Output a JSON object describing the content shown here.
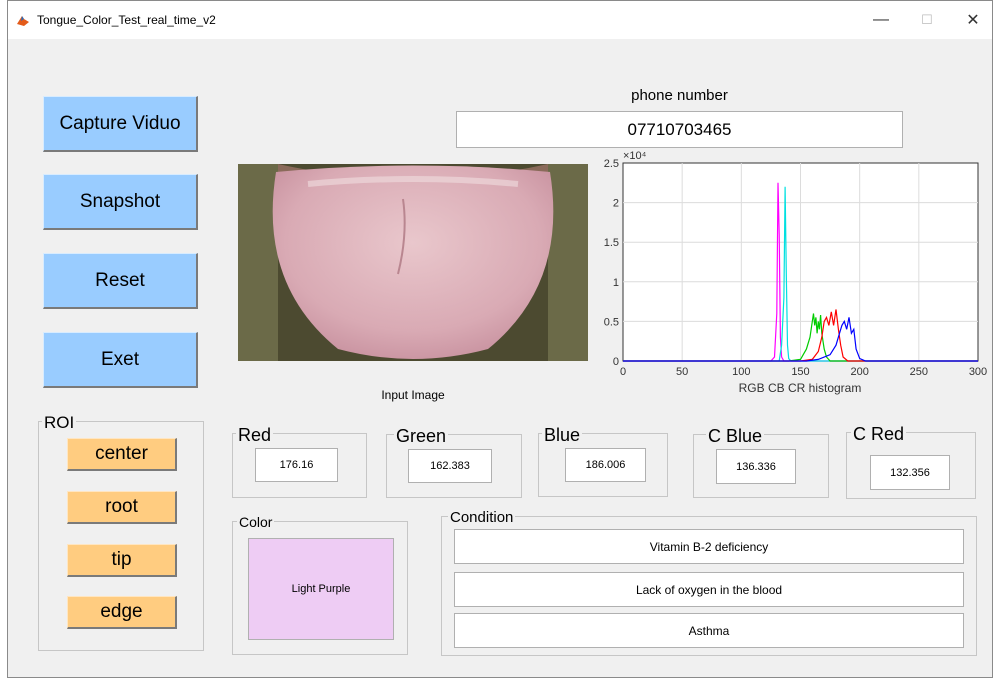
{
  "window": {
    "title": "Tongue_Color_Test_real_time_v2",
    "minimize_glyph": "—",
    "maximize_glyph": "☐",
    "close_glyph": "✕"
  },
  "buttons": {
    "capture": "Capture Viduo",
    "snapshot": "Snapshot",
    "reset": "Reset",
    "exit": "Exet"
  },
  "phone": {
    "label": "phone number",
    "value": "07710703465"
  },
  "image_label": "Input Image",
  "roi": {
    "title": "ROI",
    "center": "center",
    "root": "root",
    "tip": "tip",
    "edge": "edge"
  },
  "channels": {
    "red": {
      "label": "Red",
      "value": "176.16"
    },
    "green": {
      "label": "Green",
      "value": "162.383"
    },
    "blue": {
      "label": "Blue",
      "value": "186.006"
    },
    "cblue": {
      "label": "C Blue",
      "value": "136.336"
    },
    "cred": {
      "label": "C Red",
      "value": "132.356"
    }
  },
  "color": {
    "title": "Color",
    "value": "Light Purple",
    "swatch": "#eeccf4"
  },
  "condition": {
    "title": "Condition",
    "items": [
      "Vitamin B-2 deficiency",
      "Lack of oxygen in the blood",
      "Asthma"
    ]
  },
  "chart_data": {
    "type": "line",
    "xlabel": "RGB CB CR histogram",
    "ylabel": "",
    "exponent_label": "×10⁴",
    "xlim": [
      0,
      300
    ],
    "ylim": [
      0,
      2.5
    ],
    "xticks": [
      0,
      50,
      100,
      150,
      200,
      250,
      300
    ],
    "yticks": [
      0,
      0.5,
      1,
      1.5,
      2,
      2.5
    ],
    "grid": true,
    "series": [
      {
        "color": "#ff00ff",
        "x": [
          0,
          125,
          128,
          130,
          131,
          132,
          133,
          134,
          136,
          138,
          145,
          300
        ],
        "y": [
          0,
          0,
          0.05,
          0.6,
          2.25,
          1.6,
          0.3,
          0.05,
          0,
          0,
          0,
          0
        ]
      },
      {
        "color": "#00e0e0",
        "x": [
          0,
          132,
          134,
          136,
          137,
          138,
          139,
          140,
          142,
          150,
          300
        ],
        "y": [
          0,
          0,
          0.2,
          0.8,
          2.2,
          1.1,
          0.2,
          0.03,
          0,
          0,
          0
        ]
      },
      {
        "color": "#00cc00",
        "x": [
          0,
          140,
          150,
          155,
          158,
          160,
          161,
          162,
          163,
          164,
          165,
          166,
          167,
          168,
          170,
          172,
          175,
          300
        ],
        "y": [
          0,
          0,
          0.02,
          0.15,
          0.3,
          0.5,
          0.6,
          0.45,
          0.55,
          0.35,
          0.5,
          0.4,
          0.58,
          0.35,
          0.15,
          0.05,
          0,
          0
        ]
      },
      {
        "color": "#ff0000",
        "x": [
          0,
          150,
          160,
          165,
          168,
          170,
          172,
          174,
          176,
          178,
          180,
          182,
          184,
          186,
          190,
          300
        ],
        "y": [
          0,
          0,
          0.02,
          0.12,
          0.3,
          0.5,
          0.55,
          0.45,
          0.62,
          0.45,
          0.65,
          0.4,
          0.2,
          0.05,
          0,
          0
        ]
      },
      {
        "color": "#0000ff",
        "x": [
          0,
          155,
          165,
          175,
          180,
          183,
          185,
          187,
          189,
          191,
          193,
          195,
          197,
          200,
          205,
          300
        ],
        "y": [
          0,
          0,
          0.02,
          0.08,
          0.2,
          0.35,
          0.45,
          0.5,
          0.4,
          0.55,
          0.35,
          0.4,
          0.15,
          0.03,
          0,
          0
        ]
      }
    ]
  }
}
